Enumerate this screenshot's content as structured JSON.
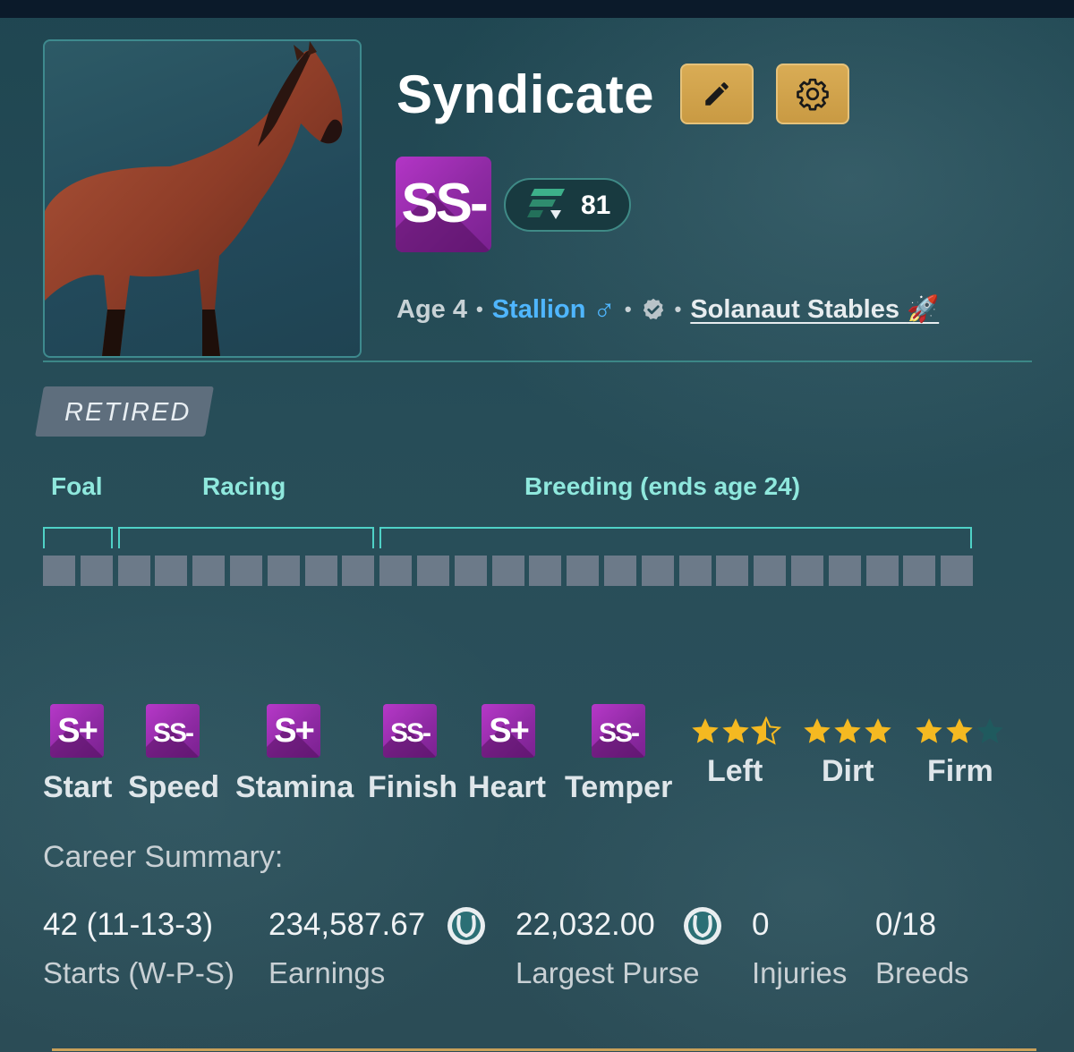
{
  "horse": {
    "name": "Syndicate",
    "grade": "SS-",
    "rating": "81",
    "age": "Age 4",
    "sex": "Stallion",
    "sex_symbol": "♂",
    "separator": "•",
    "stable": "Solanaut Stables",
    "stable_emoji": "🚀",
    "status": "RETIRED"
  },
  "actions": {
    "edit_icon": "pencil-icon",
    "settings_icon": "gear-icon"
  },
  "lifecycle": {
    "phases": [
      {
        "label": "Foal",
        "cells": 2
      },
      {
        "label": "Racing",
        "cells": 7
      },
      {
        "label": "Breeding (ends age 24)",
        "cells": 16
      }
    ],
    "total_cells": 25,
    "filled_cells": 0
  },
  "stats": [
    {
      "grade": "S+",
      "label": "Start"
    },
    {
      "grade": "SS-",
      "label": "Speed"
    },
    {
      "grade": "S+",
      "label": "Stamina"
    },
    {
      "grade": "SS-",
      "label": "Finish"
    },
    {
      "grade": "S+",
      "label": "Heart"
    },
    {
      "grade": "SS-",
      "label": "Temper"
    }
  ],
  "preferences": [
    {
      "label": "Left",
      "stars": 2.5,
      "max": 3
    },
    {
      "label": "Dirt",
      "stars": 3,
      "max": 3
    },
    {
      "label": "Firm",
      "stars": 2,
      "max": 3
    }
  ],
  "career": {
    "title": "Career Summary:",
    "items": [
      {
        "value": "42 (11-13-3)",
        "label": "Starts (W-P-S)"
      },
      {
        "value": "234,587.67",
        "label": "Earnings",
        "coin": true
      },
      {
        "value": "22,032.00",
        "label": "Largest Purse",
        "coin": true
      },
      {
        "value": "0",
        "label": "Injuries"
      },
      {
        "value": "0/18",
        "label": "Breeds"
      }
    ]
  },
  "colors": {
    "accent_teal": "#4fd1c6",
    "grade_purple": "#9a2fb0",
    "gold": "#d4a44c",
    "star_gold": "#f5b921",
    "link_blue": "#4fb6ff"
  }
}
